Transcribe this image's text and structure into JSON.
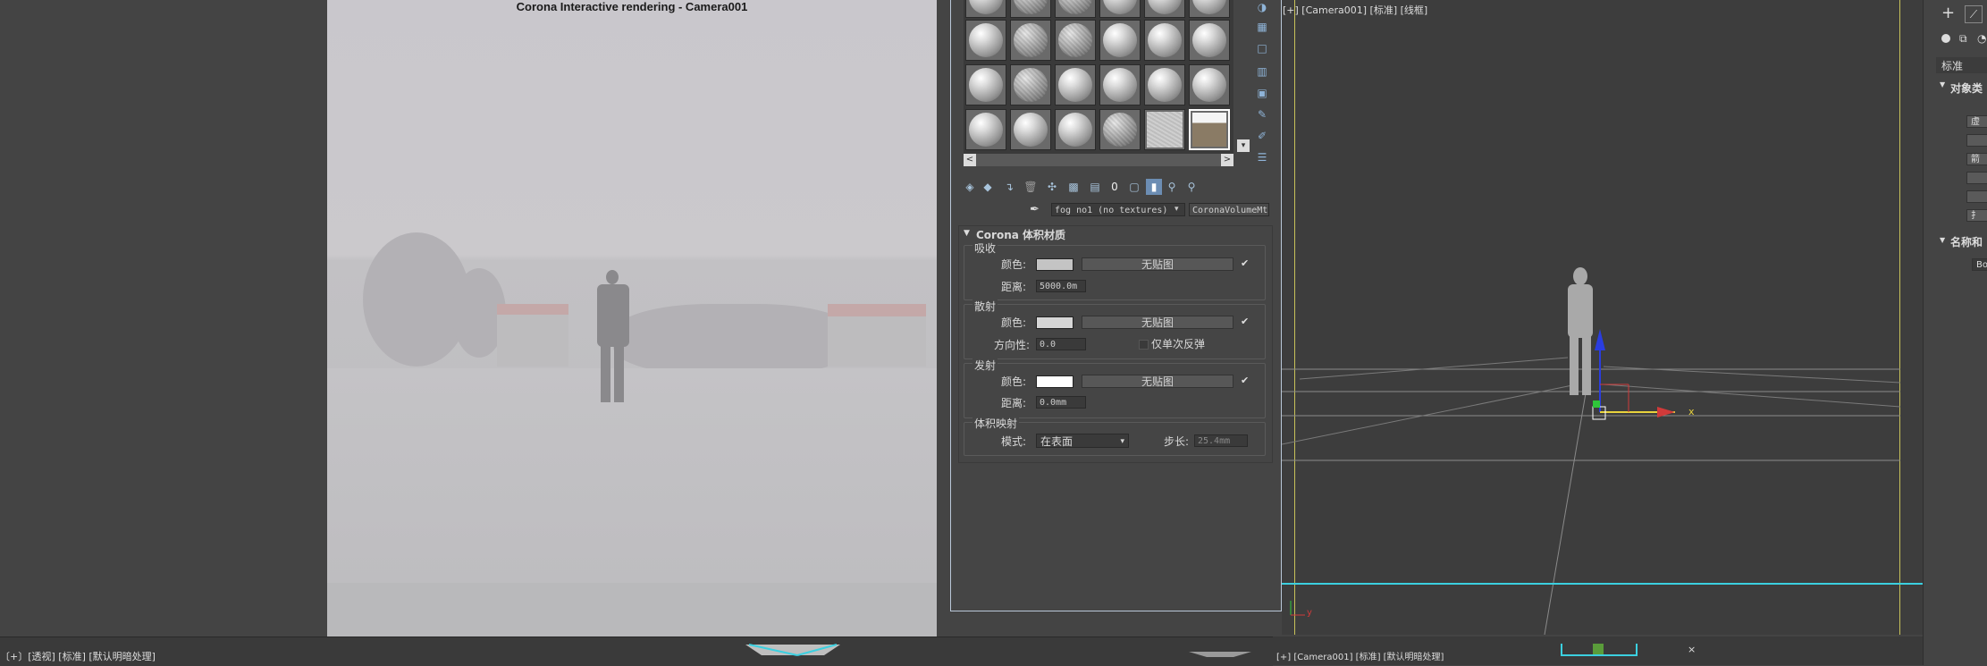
{
  "render_window": {
    "title": "Corona Interactive rendering - Camera001"
  },
  "left_status": "〔+〕[透视] [标准] [默认明暗处理]",
  "material_editor": {
    "material_name": "fog no1 (no textures)",
    "material_type": "CoronaVolumeMtl",
    "rollout_title": "Corona 体积材质",
    "absorption": {
      "group_label": "吸收",
      "color_label": "颜色:",
      "color": "#c4c4c4",
      "map_label": "无贴图",
      "distance_label": "距离:",
      "distance_value": "5000.0m"
    },
    "scattering": {
      "group_label": "散射",
      "color_label": "颜色:",
      "color": "#d6d6d6",
      "map_label": "无贴图",
      "directionality_label": "方向性:",
      "directionality_value": "0.0",
      "single_bounce_label": "仅单次反弹"
    },
    "emission": {
      "group_label": "发射",
      "color_label": "颜色:",
      "color": "#ffffff",
      "map_label": "无贴图",
      "distance_label": "距离:",
      "distance_value": "0.0mm"
    },
    "volumetric_displacement": {
      "group_label": "体积映射",
      "mode_label": "模式:",
      "mode_value": "在表面",
      "step_label": "步长:",
      "step_value": "25.4mm"
    },
    "scroll_left": "<",
    "scroll_right": ">"
  },
  "viewport": {
    "label": "[+] [Camera001] [标准] [线框]",
    "axis_x": "x",
    "axis_y": "y",
    "bottom_label": "[+] [Camera001] [标准] [默认明暗处理]"
  },
  "command_panel": {
    "tab_label": "标准",
    "rollout_object_type": "对象类",
    "rollout_name_color": "名称和",
    "buttons": [
      "虚",
      "",
      "箭",
      "",
      "",
      "扌"
    ],
    "name_field": "Bo"
  },
  "colors": {
    "accent_cyan": "#3bd0e0",
    "safe_frame_yellow": "#c8c25a",
    "grid_gray": "#9a9a9a"
  }
}
